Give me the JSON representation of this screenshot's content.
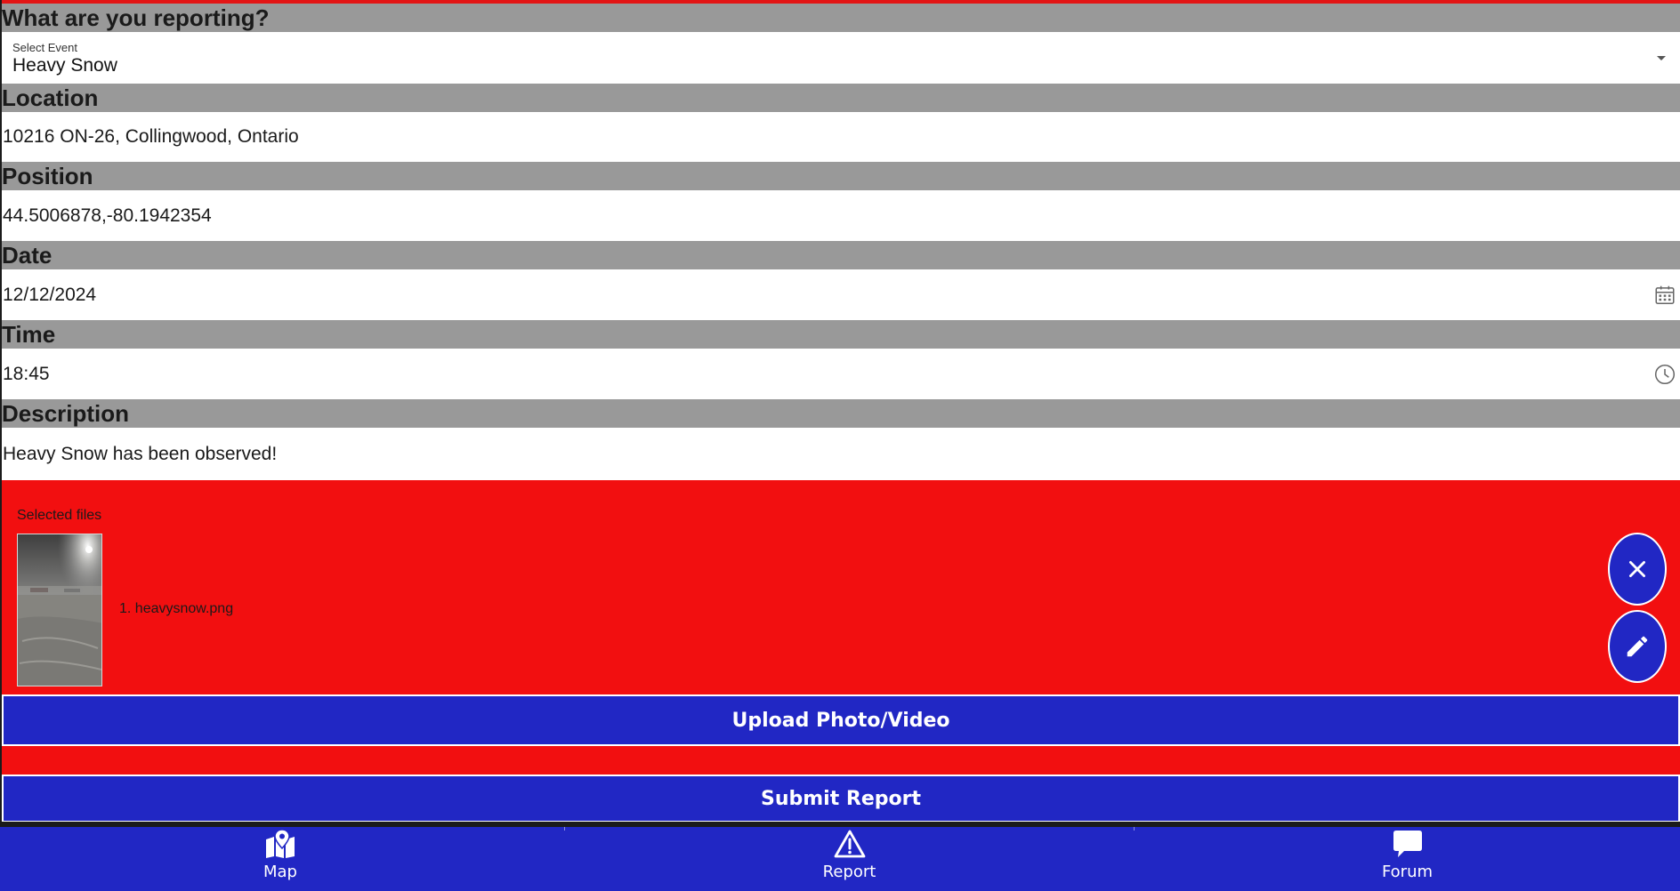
{
  "form": {
    "event_header": "What are you reporting?",
    "event_select": {
      "label": "Select Event",
      "value": "Heavy Snow"
    },
    "location_header": "Location",
    "location_value": "10216 ON-26, Collingwood, Ontario",
    "position_header": "Position",
    "position_value": "44.5006878,-80.1942354",
    "date_header": "Date",
    "date_value": "12/12/2024",
    "time_header": "Time",
    "time_value": "18:45",
    "description_header": "Description",
    "description_value": "Heavy Snow has been observed!"
  },
  "files": {
    "title": "Selected files",
    "items": [
      {
        "name": "1. heavysnow.png"
      }
    ]
  },
  "actions": {
    "upload_label": "Upload Photo/Video",
    "submit_label": "Submit Report"
  },
  "fab": {
    "clear_icon": "close-icon",
    "edit_icon": "pencil-icon"
  },
  "nav": {
    "items": [
      {
        "label": "Map",
        "icon": "map-icon"
      },
      {
        "label": "Report",
        "icon": "warning-icon"
      },
      {
        "label": "Forum",
        "icon": "chat-icon"
      }
    ]
  },
  "colors": {
    "header_gray": "#999999",
    "panel_red": "#f20f10",
    "primary_blue": "#2127c4",
    "top_accent": "#e31515"
  }
}
